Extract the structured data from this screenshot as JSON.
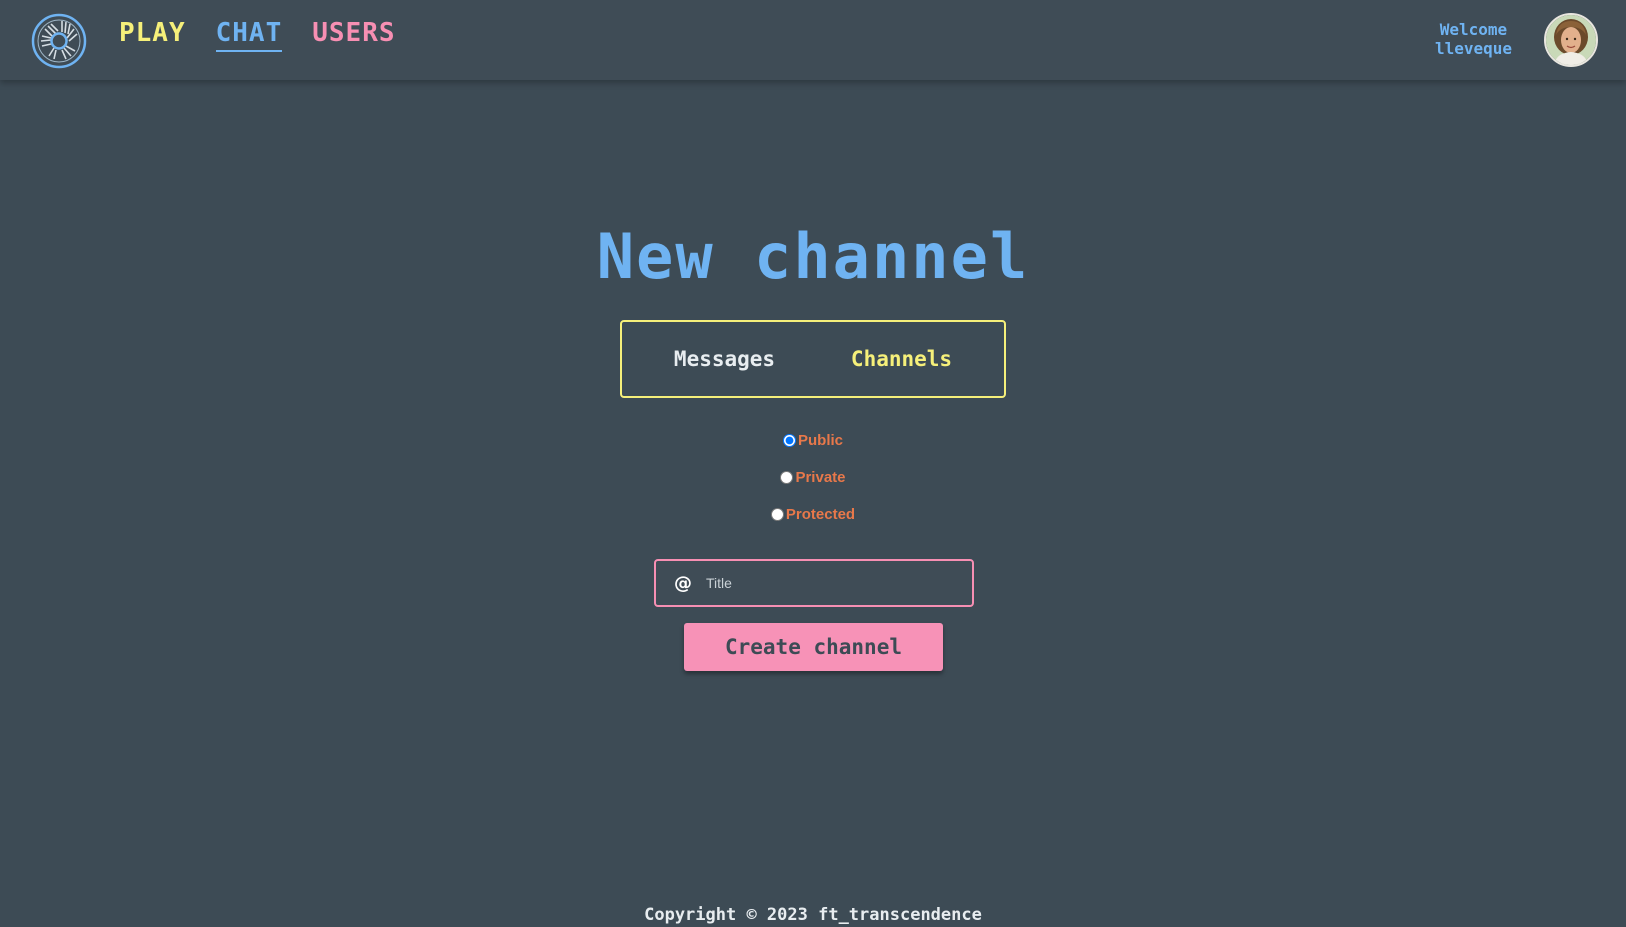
{
  "header": {
    "nav": [
      {
        "label": "PLAY",
        "color": "#f6f07a"
      },
      {
        "label": "CHAT",
        "color": "#6fb3f2",
        "active": true
      },
      {
        "label": "USERS",
        "color": "#f78fb3"
      }
    ],
    "welcome_line1": "Welcome",
    "welcome_line2": "lleveque"
  },
  "main": {
    "page_title": "New channel",
    "tabs": [
      {
        "label": "Messages",
        "active": false
      },
      {
        "label": "Channels",
        "active": true
      }
    ],
    "visibility_options": [
      {
        "label": "Public",
        "checked": true
      },
      {
        "label": "Private",
        "checked": false
      },
      {
        "label": "Protected",
        "checked": false
      }
    ],
    "title_input": {
      "placeholder": "Title",
      "value": ""
    },
    "create_button_label": "Create channel"
  },
  "footer": {
    "copyright": "Copyright © 2023 ft_transcendence"
  },
  "colors": {
    "background": "#3d4b55",
    "accent_blue": "#6fb3f2",
    "accent_yellow": "#f6f07a",
    "accent_pink": "#f78fb3",
    "accent_orange": "#e8784a"
  },
  "icons": [
    "logo-icon",
    "at-icon",
    "avatar"
  ]
}
